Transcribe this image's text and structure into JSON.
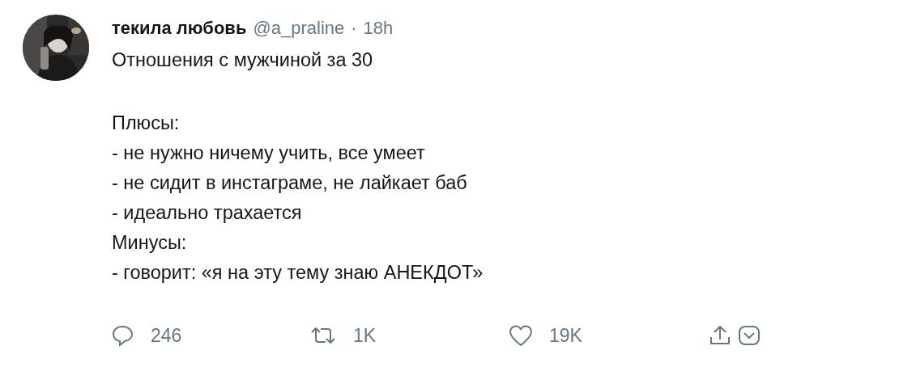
{
  "author": {
    "name": "текила любовь",
    "handle": "@a_praline",
    "separator": "·",
    "time": "18h"
  },
  "tweet": {
    "paragraphs": [
      [
        "Отношения с мужчиной за 30"
      ],
      [
        "Плюсы:",
        "- не нужно ничему учить, все умеет",
        "- не сидит в инстаграме, не лайкает баб",
        "- идеально трахается",
        "Минусы:",
        "- говорит: «я на эту тему знаю АНЕКДОТ»"
      ]
    ]
  },
  "actions": [
    {
      "kind": "reply",
      "count": "246"
    },
    {
      "kind": "retweet",
      "count": "1K"
    },
    {
      "kind": "like",
      "count": "19K"
    },
    {
      "kind": "share"
    },
    {
      "kind": "dm"
    }
  ]
}
